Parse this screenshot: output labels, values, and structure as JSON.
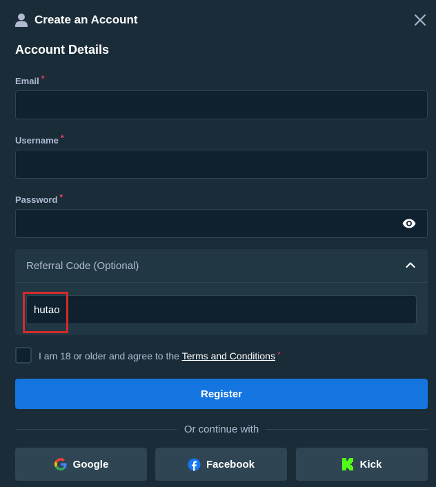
{
  "header": {
    "title": "Create an Account",
    "icon": "user-icon"
  },
  "section_title": "Account Details",
  "fields": {
    "email": {
      "label": "Email",
      "required_mark": "*",
      "value": ""
    },
    "username": {
      "label": "Username",
      "required_mark": "*",
      "value": ""
    },
    "password": {
      "label": "Password",
      "required_mark": "*",
      "value": ""
    }
  },
  "referral": {
    "label": "Referral Code (Optional)",
    "expanded": true,
    "value": "hutao"
  },
  "agreement": {
    "text": "I am 18 or older and agree to the",
    "link": "Terms and Conditions",
    "required_mark": "*",
    "checked": false
  },
  "register_label": "Register",
  "divider_text": "Or continue with",
  "social": [
    {
      "label": "Google",
      "icon": "google-icon"
    },
    {
      "label": "Facebook",
      "icon": "facebook-icon"
    },
    {
      "label": "Kick",
      "icon": "kick-icon"
    }
  ],
  "colors": {
    "background": "#1a2c38",
    "input_bg": "#0f212e",
    "border": "#2f4553",
    "accent_blue": "#1475e1",
    "required_red": "#ed4163",
    "highlight_red": "#d62a2a",
    "kick_green": "#53fc18"
  }
}
